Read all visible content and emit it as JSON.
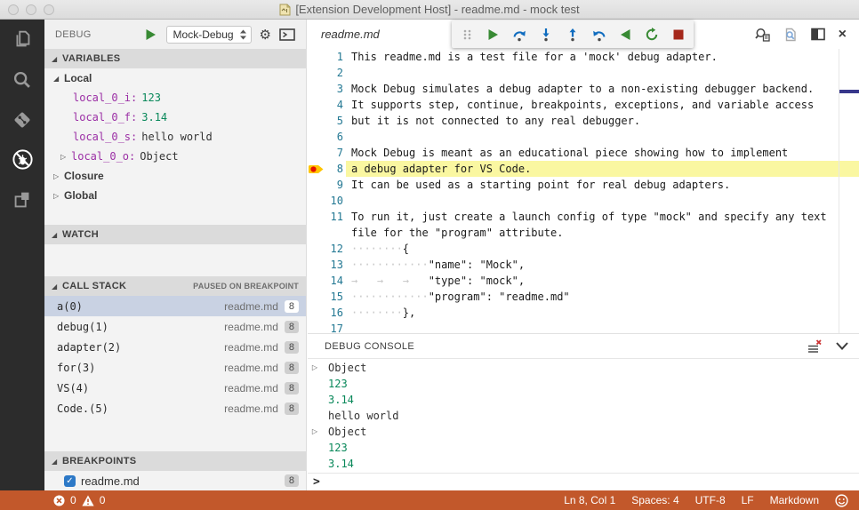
{
  "window": {
    "title": "[Extension Development Host] - readme.md - mock test"
  },
  "icons": {
    "twistie_expanded": "◢",
    "twistie_collapsed": "▷",
    "gear": "⚙",
    "close": "×",
    "checkmark": "✓"
  },
  "activity_bar": {
    "items": [
      "explorer",
      "search",
      "source-control",
      "debug",
      "extensions"
    ],
    "active": "debug"
  },
  "sidebar": {
    "title": "DEBUG",
    "launch_config": "Mock-Debug",
    "variables": {
      "header": "VARIABLES",
      "scope_local": "Local",
      "scope_closure": "Closure",
      "scope_global": "Global",
      "locals": [
        {
          "name": "local_0_i:",
          "value": "123",
          "kind": "number"
        },
        {
          "name": "local_0_f:",
          "value": "3.14",
          "kind": "number"
        },
        {
          "name": "local_0_s:",
          "value": "hello world",
          "kind": "string"
        },
        {
          "name": "local_0_o:",
          "value": "Object",
          "kind": "object"
        }
      ]
    },
    "watch": {
      "header": "WATCH"
    },
    "call_stack": {
      "header": "CALL STACK",
      "status": "PAUSED ON BREAKPOINT",
      "frames": [
        {
          "fn": "a(0)",
          "file": "readme.md",
          "line": "8"
        },
        {
          "fn": "debug(1)",
          "file": "readme.md",
          "line": "8"
        },
        {
          "fn": "adapter(2)",
          "file": "readme.md",
          "line": "8"
        },
        {
          "fn": "for(3)",
          "file": "readme.md",
          "line": "8"
        },
        {
          "fn": "VS(4)",
          "file": "readme.md",
          "line": "8"
        },
        {
          "fn": "Code.(5)",
          "file": "readme.md",
          "line": "8"
        }
      ]
    },
    "breakpoints": {
      "header": "BREAKPOINTS",
      "items": [
        {
          "file": "readme.md",
          "line": "8",
          "enabled": true
        }
      ]
    }
  },
  "editor": {
    "file_name": "readme.md",
    "lines": [
      {
        "num": "1",
        "indent": "",
        "text": "This readme.md is a test file for a 'mock' debug adapter."
      },
      {
        "num": "2",
        "indent": "",
        "text": ""
      },
      {
        "num": "3",
        "indent": "",
        "text": "Mock Debug simulates a debug adapter to a non-existing debugger backend."
      },
      {
        "num": "4",
        "indent": "",
        "text": "It supports step, continue, breakpoints, exceptions, and variable access"
      },
      {
        "num": "5",
        "indent": "",
        "text": "but it is not connected to any real debugger."
      },
      {
        "num": "6",
        "indent": "",
        "text": ""
      },
      {
        "num": "7",
        "indent": "",
        "text": "Mock Debug is meant as an educational piece showing how to implement"
      },
      {
        "num": "8",
        "indent": "",
        "text": "a debug adapter for VS Code."
      },
      {
        "num": "9",
        "indent": "",
        "text": "It can be used as a starting point for real debug adapters."
      },
      {
        "num": "10",
        "indent": "",
        "text": ""
      },
      {
        "num": "11",
        "indent": "",
        "text": "To run it, just create a launch config of type \"mock\" and specify any text"
      },
      {
        "num": "",
        "indent": "",
        "text": "file for the \"program\" attribute."
      },
      {
        "num": "12",
        "indent": "········",
        "text": "{"
      },
      {
        "num": "13",
        "indent": "············",
        "text": "\"name\": \"Mock\","
      },
      {
        "num": "14",
        "indent": "→   →   →   ",
        "text": "\"type\": \"mock\","
      },
      {
        "num": "15",
        "indent": "············",
        "text": "\"program\": \"readme.md\""
      },
      {
        "num": "16",
        "indent": "········",
        "text": "},"
      },
      {
        "num": "17",
        "indent": "",
        "text": ""
      }
    ],
    "current_line": "8"
  },
  "debug_toolbar": {
    "buttons": [
      "continue",
      "step-over",
      "step-into",
      "step-out",
      "step-back",
      "reverse-continue",
      "restart",
      "stop"
    ]
  },
  "debug_console": {
    "header": "DEBUG CONSOLE",
    "entries": [
      {
        "text": "Object",
        "kind": "object"
      },
      {
        "text": "123",
        "kind": "number"
      },
      {
        "text": "3.14",
        "kind": "number"
      },
      {
        "text": "hello world",
        "kind": "string"
      },
      {
        "text": "Object",
        "kind": "object"
      },
      {
        "text": "123",
        "kind": "number"
      },
      {
        "text": "3.14",
        "kind": "number"
      }
    ],
    "prompt": ">"
  },
  "status_bar": {
    "errors": "0",
    "warnings": "0",
    "cursor": "Ln 8, Col 1",
    "indentation": "Spaces: 4",
    "encoding": "UTF-8",
    "eol": "LF",
    "language": "Markdown"
  },
  "colors": {
    "status_bar": "#C2582B",
    "activity_bar": "#2C2C2C",
    "current_line_highlight": "#FAF7A1",
    "breakpoint_red": "#E51400",
    "breakpoint_arrow_yellow": "#FFC500",
    "number_value_green": "#09885A",
    "variable_purple": "#9B2FA5",
    "line_number_blue": "#237893",
    "debug_step_blue": "#0F6CBF",
    "debug_continue_green": "#388A34",
    "debug_stop_red": "#A5281B",
    "selected_frame": "#C9D2E3"
  }
}
